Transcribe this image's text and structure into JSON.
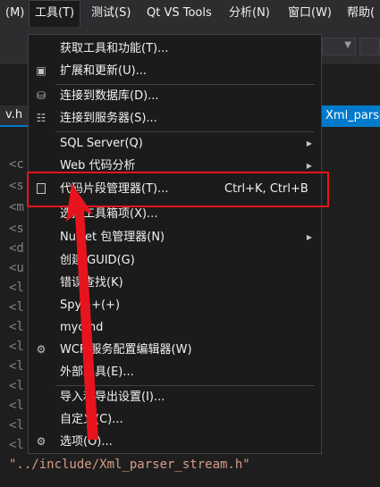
{
  "menubar": {
    "items": [
      "(M)",
      "工具(T)",
      "测试(S)",
      "Qt VS Tools",
      "分析(N)",
      "窗口(W)",
      "帮助("
    ],
    "active_index": 1
  },
  "tabs": {
    "left_label": "v.h",
    "right_label": "Xml_parse"
  },
  "menu": {
    "items": [
      {
        "label": "获取工具和功能(T)...",
        "icon": ""
      },
      {
        "label": "扩展和更新(U)...",
        "icon": "extensions-icon"
      },
      {
        "label": "连接到数据库(D)...",
        "icon": "database-connect-icon"
      },
      {
        "label": "连接到服务器(S)...",
        "icon": "server-connect-icon"
      },
      {
        "label": "SQL Server(Q)",
        "icon": ""
      },
      {
        "label": "Web 代码分析",
        "icon": ""
      },
      {
        "label": "代码片段管理器(T)...",
        "icon": "snippet-icon",
        "shortcut": "Ctrl+K, Ctrl+B"
      },
      {
        "label": "选择工具箱项(X)...",
        "icon": ""
      },
      {
        "label": "NuGet 包管理器(N)",
        "icon": ""
      },
      {
        "label": "创建 GUID(G)",
        "icon": ""
      },
      {
        "label": "错误查找(K)",
        "icon": ""
      },
      {
        "label": "Spy++(+)",
        "icon": ""
      },
      {
        "label": "mycmd",
        "icon": ""
      },
      {
        "label": "WCF 服务配置编辑器(W)",
        "icon": "wcf-gear-icon"
      },
      {
        "label": "外部工具(E)...",
        "icon": ""
      },
      {
        "label": "导入和导出设置(I)...",
        "icon": ""
      },
      {
        "label": "自定义(C)...",
        "icon": ""
      },
      {
        "label": "选项(O)...",
        "icon": "gear-icon"
      }
    ]
  },
  "editor": {
    "line_prefixes": [
      "<c",
      "<s",
      "<m",
      "<s",
      "<d",
      "<u",
      "<l",
      "<l",
      "<l",
      "<l",
      "<l",
      "<l",
      "<l",
      "<l",
      "<l"
    ],
    "bottom_line": "\"../include/Xml_parser_stream.h\""
  },
  "colors": {
    "accent": "#007acc",
    "highlight": "#e8141d",
    "menu_bg": "#1b1b1c"
  }
}
